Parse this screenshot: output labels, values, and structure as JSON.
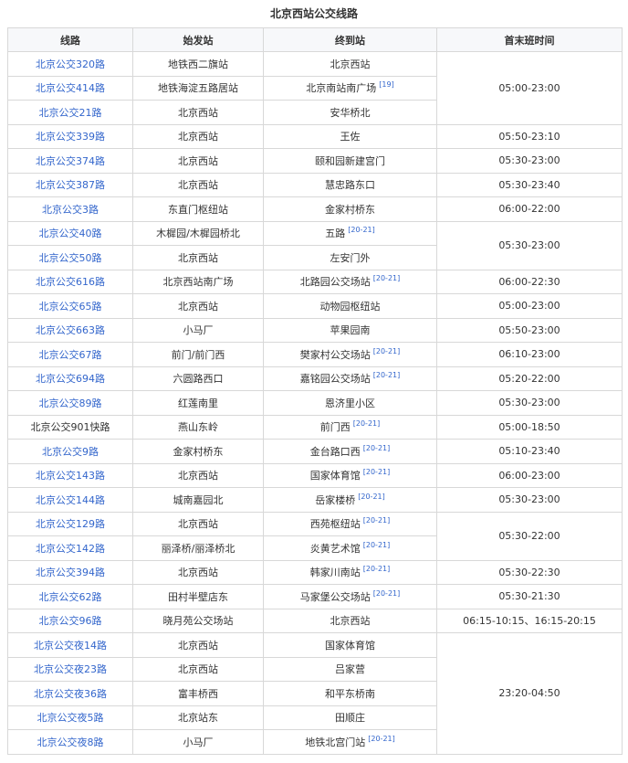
{
  "title": "北京西站公交线路",
  "headers": [
    "线路",
    "始发站",
    "终到站",
    "首末班时间"
  ],
  "rows": [
    {
      "line": "北京公交320路",
      "link": true,
      "start": "地铁西二旗站",
      "end": "北京西站",
      "ref": "",
      "time": "05:00-23:00",
      "span": 3
    },
    {
      "line": "北京公交414路",
      "link": true,
      "start": "地铁海淀五路居站",
      "end": "北京南站南广场",
      "ref": "[19]"
    },
    {
      "line": "北京公交21路",
      "link": true,
      "start": "北京西站",
      "end": "安华桥北",
      "ref": ""
    },
    {
      "line": "北京公交339路",
      "link": true,
      "start": "北京西站",
      "end": "王佐",
      "ref": "",
      "time": "05:50-23:10",
      "span": 1
    },
    {
      "line": "北京公交374路",
      "link": true,
      "start": "北京西站",
      "end": "颐和园新建宫门",
      "ref": "",
      "time": "05:30-23:00",
      "span": 1
    },
    {
      "line": "北京公交387路",
      "link": true,
      "start": "北京西站",
      "end": "慧忠路东口",
      "ref": "",
      "time": "05:30-23:40",
      "span": 1
    },
    {
      "line": "北京公交3路",
      "link": true,
      "start": "东直门枢纽站",
      "end": "金家村桥东",
      "ref": "",
      "time": "06:00-22:00",
      "span": 1
    },
    {
      "line": "北京公交40路",
      "link": true,
      "start": "木樨园/木樨园桥北",
      "end": "五路",
      "ref": "[20-21]",
      "time": "05:30-23:00",
      "span": 2
    },
    {
      "line": "北京公交50路",
      "link": true,
      "start": "北京西站",
      "end": "左安门外",
      "ref": ""
    },
    {
      "line": "北京公交616路",
      "link": true,
      "start": "北京西站南广场",
      "end": "北路园公交场站",
      "ref": "[20-21]",
      "time": "06:00-22:30",
      "span": 1
    },
    {
      "line": "北京公交65路",
      "link": true,
      "start": "北京西站",
      "end": "动物园枢纽站",
      "ref": "",
      "time": "05:00-23:00",
      "span": 1
    },
    {
      "line": "北京公交663路",
      "link": true,
      "start": "小马厂",
      "end": "苹果园南",
      "ref": "",
      "time": "05:50-23:00",
      "span": 1
    },
    {
      "line": "北京公交67路",
      "link": true,
      "start": "前门/前门西",
      "end": "樊家村公交场站",
      "ref": "[20-21]",
      "time": "06:10-23:00",
      "span": 1
    },
    {
      "line": "北京公交694路",
      "link": true,
      "start": "六圆路西口",
      "end": "嘉铭园公交场站",
      "ref": "[20-21]",
      "time": "05:20-22:00",
      "span": 1
    },
    {
      "line": "北京公交89路",
      "link": true,
      "start": "红莲南里",
      "end": "恩济里小区",
      "ref": "",
      "time": "05:30-23:00",
      "span": 1
    },
    {
      "line": "北京公交901快路",
      "link": false,
      "start": "燕山东岭",
      "end": "前门西",
      "ref": "[20-21]",
      "time": "05:00-18:50",
      "span": 1
    },
    {
      "line": "北京公交9路",
      "link": true,
      "start": "金家村桥东",
      "end": "金台路口西",
      "ref": "[20-21]",
      "time": "05:10-23:40",
      "span": 1
    },
    {
      "line": "北京公交143路",
      "link": true,
      "start": "北京西站",
      "end": "国家体育馆",
      "ref": "[20-21]",
      "time": "06:00-23:00",
      "span": 1
    },
    {
      "line": "北京公交144路",
      "link": true,
      "start": "城南嘉园北",
      "end": "岳家楼桥",
      "ref": "[20-21]",
      "time": "05:30-23:00",
      "span": 1
    },
    {
      "line": "北京公交129路",
      "link": true,
      "start": "北京西站",
      "end": "西苑枢纽站",
      "ref": "[20-21]",
      "time": "05:30-22:00",
      "span": 2
    },
    {
      "line": "北京公交142路",
      "link": true,
      "start": "丽泽桥/丽泽桥北",
      "end": "炎黄艺术馆",
      "ref": "[20-21]"
    },
    {
      "line": "北京公交394路",
      "link": true,
      "start": "北京西站",
      "end": "韩家川南站",
      "ref": "[20-21]",
      "time": "05:30-22:30",
      "span": 1
    },
    {
      "line": "北京公交62路",
      "link": true,
      "start": "田村半壁店东",
      "end": "马家堡公交场站",
      "ref": "[20-21]",
      "time": "05:30-21:30",
      "span": 1
    },
    {
      "line": "北京公交96路",
      "link": true,
      "start": "晓月苑公交场站",
      "end": "北京西站",
      "ref": "",
      "time": "06:15-10:15、16:15-20:15",
      "span": 1
    },
    {
      "line": "北京公交夜14路",
      "link": true,
      "start": "北京西站",
      "end": "国家体育馆",
      "ref": "",
      "time": "23:20-04:50",
      "span": 6
    },
    {
      "line": "北京公交夜23路",
      "link": true,
      "start": "北京西站",
      "end": "吕家营",
      "ref": ""
    },
    {
      "line": "北京公交夜36路",
      "link": true,
      "start": "富丰桥西",
      "end": "和平东桥南",
      "ref": ""
    },
    {
      "line": "北京公交夜5路",
      "link": true,
      "start": "北京站东",
      "end": "田顺庄",
      "ref": ""
    },
    {
      "line": "北京公交夜8路",
      "link": true,
      "start": "小马厂",
      "end": "地铁北宫门站",
      "ref": "[20-21]"
    }
  ]
}
